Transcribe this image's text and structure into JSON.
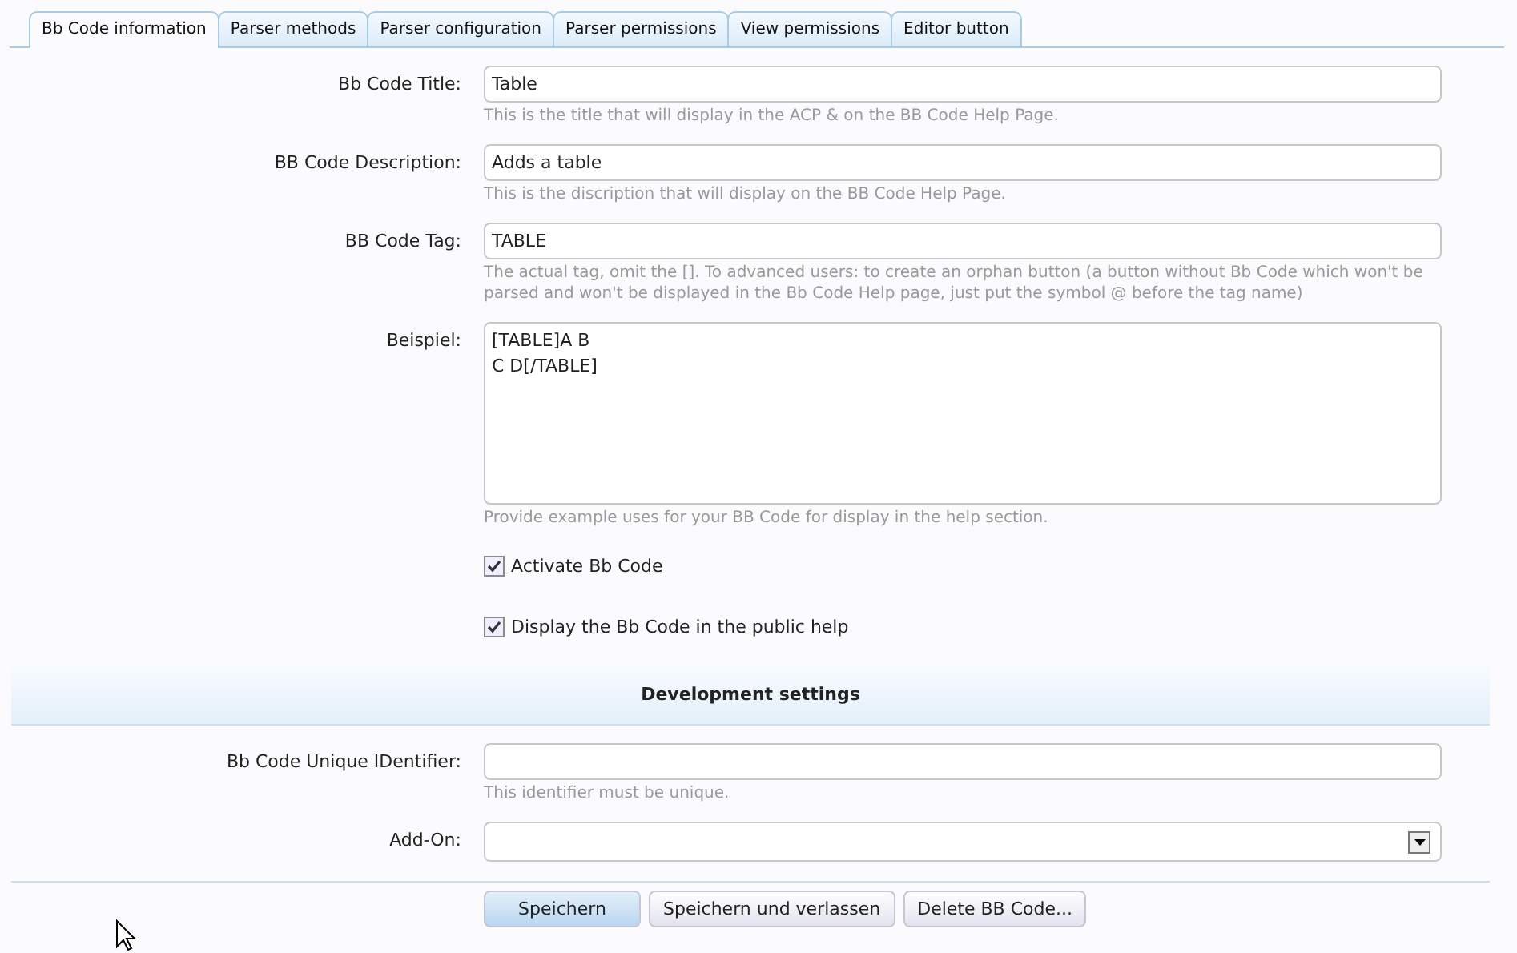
{
  "tabs": [
    {
      "label": "Bb Code information",
      "selected": true
    },
    {
      "label": "Parser methods",
      "selected": false
    },
    {
      "label": "Parser configuration",
      "selected": false
    },
    {
      "label": "Parser permissions",
      "selected": false
    },
    {
      "label": "View permissions",
      "selected": false
    },
    {
      "label": "Editor button",
      "selected": false
    }
  ],
  "fields": [
    {
      "kind": "text",
      "label": "Bb Code Title:",
      "value": "Table",
      "hint": "This is the title that will display in the ACP & on the BB Code Help Page."
    },
    {
      "kind": "text",
      "label": "BB Code Description:",
      "value": "Adds a table",
      "hint": "This is the discription that will display on the BB Code Help Page."
    },
    {
      "kind": "text",
      "label": "BB Code Tag:",
      "value": "TABLE",
      "hint": "The actual tag, omit the []. To advanced users: to create an orphan button (a button without Bb Code which won't be parsed and won't be displayed in the Bb Code Help page, just put the symbol @ before the tag name)"
    },
    {
      "kind": "textarea",
      "label": "Beispiel:",
      "value": "[TABLE]A B\nC D[/TABLE]",
      "hint": "Provide example uses for your BB Code for display in the help section."
    },
    {
      "kind": "checkbox",
      "label": "Activate Bb Code",
      "checked": true
    },
    {
      "kind": "checkbox",
      "label": "Display the Bb Code in the public help",
      "checked": true
    }
  ],
  "development": {
    "heading": "Development settings",
    "fields": [
      {
        "kind": "text",
        "label": "Bb Code Unique IDentifier:",
        "hint": "This identifier must be unique."
      },
      {
        "kind": "select",
        "label": "Add-On:"
      }
    ]
  },
  "buttons": [
    {
      "label": "Speichern",
      "primary": true
    },
    {
      "label": "Speichern und verlassen",
      "primary": false
    },
    {
      "label": "Delete BB Code...",
      "primary": false
    }
  ]
}
